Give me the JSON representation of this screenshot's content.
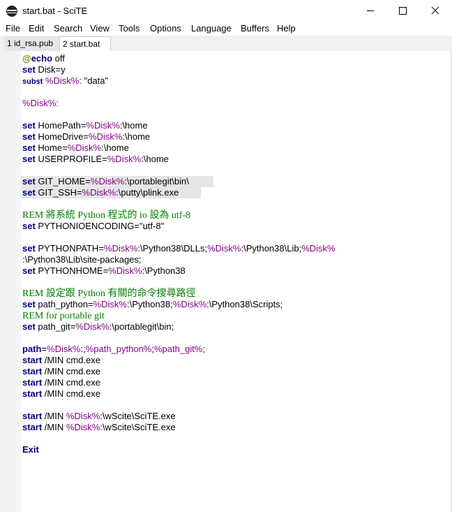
{
  "window": {
    "title": "start.bat - SciTE"
  },
  "menu": [
    "File",
    "Edit",
    "Search",
    "View",
    "Tools",
    "Options",
    "Language",
    "Buffers",
    "Help"
  ],
  "tabs": [
    "1 id_rsa.pub",
    "2 start.bat"
  ],
  "lines": [
    [
      {
        "t": "@",
        "c": "at"
      },
      {
        "t": "echo",
        "c": "kw"
      },
      {
        "t": " off",
        "c": "op"
      }
    ],
    [
      {
        "t": "set",
        "c": "kw"
      },
      {
        "t": " Disk=y",
        "c": "op"
      }
    ],
    [
      {
        "t": "subst",
        "c": "kwsm"
      },
      {
        "t": " ",
        "c": "op"
      },
      {
        "t": "%Disk%",
        "c": "var"
      },
      {
        "t": ": \"data\"",
        "c": "op"
      }
    ],
    [],
    [
      {
        "t": "%Disk%:",
        "c": "lbl"
      }
    ],
    [],
    [
      {
        "t": "set",
        "c": "kw"
      },
      {
        "t": " HomePath=",
        "c": "op"
      },
      {
        "t": "%Disk%",
        "c": "var"
      },
      {
        "t": ":\\home",
        "c": "op"
      }
    ],
    [
      {
        "t": "set",
        "c": "kw"
      },
      {
        "t": " HomeDrive=",
        "c": "op"
      },
      {
        "t": "%Disk%",
        "c": "var"
      },
      {
        "t": ":\\home",
        "c": "op"
      }
    ],
    [
      {
        "t": "set",
        "c": "kw"
      },
      {
        "t": " Home=",
        "c": "op"
      },
      {
        "t": "%Disk%",
        "c": "var"
      },
      {
        "t": ":\\home",
        "c": "op"
      }
    ],
    [
      {
        "t": "set",
        "c": "kw"
      },
      {
        "t": " USERPROFILE=",
        "c": "op"
      },
      {
        "t": "%Disk%",
        "c": "var"
      },
      {
        "t": ":\\home",
        "c": "op"
      }
    ],
    [],
    [
      {
        "t": "set",
        "c": "kw"
      },
      {
        "t": " GIT_HOME=",
        "c": "op"
      },
      {
        "t": "%Disk%",
        "c": "var"
      },
      {
        "t": ":\\portablegit\\bin\\",
        "c": "op"
      }
    ],
    [
      {
        "t": "set",
        "c": "kw"
      },
      {
        "t": " GIT_SSH=",
        "c": "op"
      },
      {
        "t": "%Disk%",
        "c": "var"
      },
      {
        "t": ":\\putty\\plink.exe",
        "c": "op"
      }
    ],
    [],
    [
      {
        "t": "REM 將系統 Python 程式的 io 設為 utf-8",
        "c": "rem"
      }
    ],
    [
      {
        "t": "set",
        "c": "kw"
      },
      {
        "t": " PYTHONIOENCODING=\"utf-8\"",
        "c": "op"
      }
    ],
    [],
    [
      {
        "t": "set",
        "c": "kw"
      },
      {
        "t": " PYTHONPATH=",
        "c": "op"
      },
      {
        "t": "%Disk%",
        "c": "var"
      },
      {
        "t": ":\\Python38\\DLLs;",
        "c": "op"
      },
      {
        "t": "%Disk%",
        "c": "var"
      },
      {
        "t": ":\\Python38\\Lib;",
        "c": "op"
      },
      {
        "t": "%Disk%",
        "c": "var"
      }
    ],
    [
      {
        "t": ":\\Python38\\Lib\\site-packages;",
        "c": "op"
      }
    ],
    [
      {
        "t": "set",
        "c": "kw"
      },
      {
        "t": " PYTHONHOME=",
        "c": "op"
      },
      {
        "t": "%Disk%",
        "c": "var"
      },
      {
        "t": ":\\Python38",
        "c": "op"
      }
    ],
    [],
    [
      {
        "t": "REM 設定跟 Python 有關的命令搜尋路徑",
        "c": "rem"
      }
    ],
    [
      {
        "t": "set",
        "c": "kw"
      },
      {
        "t": " path_python=",
        "c": "op"
      },
      {
        "t": "%Disk%",
        "c": "var"
      },
      {
        "t": ":\\Python38;",
        "c": "op"
      },
      {
        "t": "%Disk%",
        "c": "var"
      },
      {
        "t": ":\\Python38\\Scripts;",
        "c": "op"
      }
    ],
    [
      {
        "t": "REM for portable git",
        "c": "rem"
      }
    ],
    [
      {
        "t": "set",
        "c": "kw"
      },
      {
        "t": " path_git=",
        "c": "op"
      },
      {
        "t": "%Disk%",
        "c": "var"
      },
      {
        "t": ":\\portablegit\\bin;",
        "c": "op"
      }
    ],
    [],
    [
      {
        "t": "path",
        "c": "kw"
      },
      {
        "t": "=",
        "c": "op"
      },
      {
        "t": "%Disk%",
        "c": "var"
      },
      {
        "t": ":;",
        "c": "op"
      },
      {
        "t": "%path_python%",
        "c": "var"
      },
      {
        "t": ";",
        "c": "op"
      },
      {
        "t": "%path_git%",
        "c": "var"
      },
      {
        "t": ";",
        "c": "op"
      }
    ],
    [
      {
        "t": "start",
        "c": "kw"
      },
      {
        "t": " /MIN cmd.exe",
        "c": "op"
      }
    ],
    [
      {
        "t": "start",
        "c": "kw"
      },
      {
        "t": " /MIN cmd.exe",
        "c": "op"
      }
    ],
    [
      {
        "t": "start",
        "c": "kw"
      },
      {
        "t": " /MIN cmd.exe",
        "c": "op"
      }
    ],
    [
      {
        "t": "start",
        "c": "kw"
      },
      {
        "t": " /MIN cmd.exe",
        "c": "op"
      }
    ],
    [],
    [
      {
        "t": "start",
        "c": "kw"
      },
      {
        "t": " /MIN ",
        "c": "op"
      },
      {
        "t": "%Disk%",
        "c": "var"
      },
      {
        "t": ":\\wScite\\SciTE.exe",
        "c": "op"
      }
    ],
    [
      {
        "t": "start",
        "c": "kw"
      },
      {
        "t": " /MIN ",
        "c": "op"
      },
      {
        "t": "%Disk%",
        "c": "var"
      },
      {
        "t": ":\\wScite\\SciTE.exe",
        "c": "op"
      }
    ],
    [],
    [
      {
        "t": "Exit",
        "c": "kw"
      }
    ]
  ],
  "highlighted_lines": [
    11,
    12
  ]
}
